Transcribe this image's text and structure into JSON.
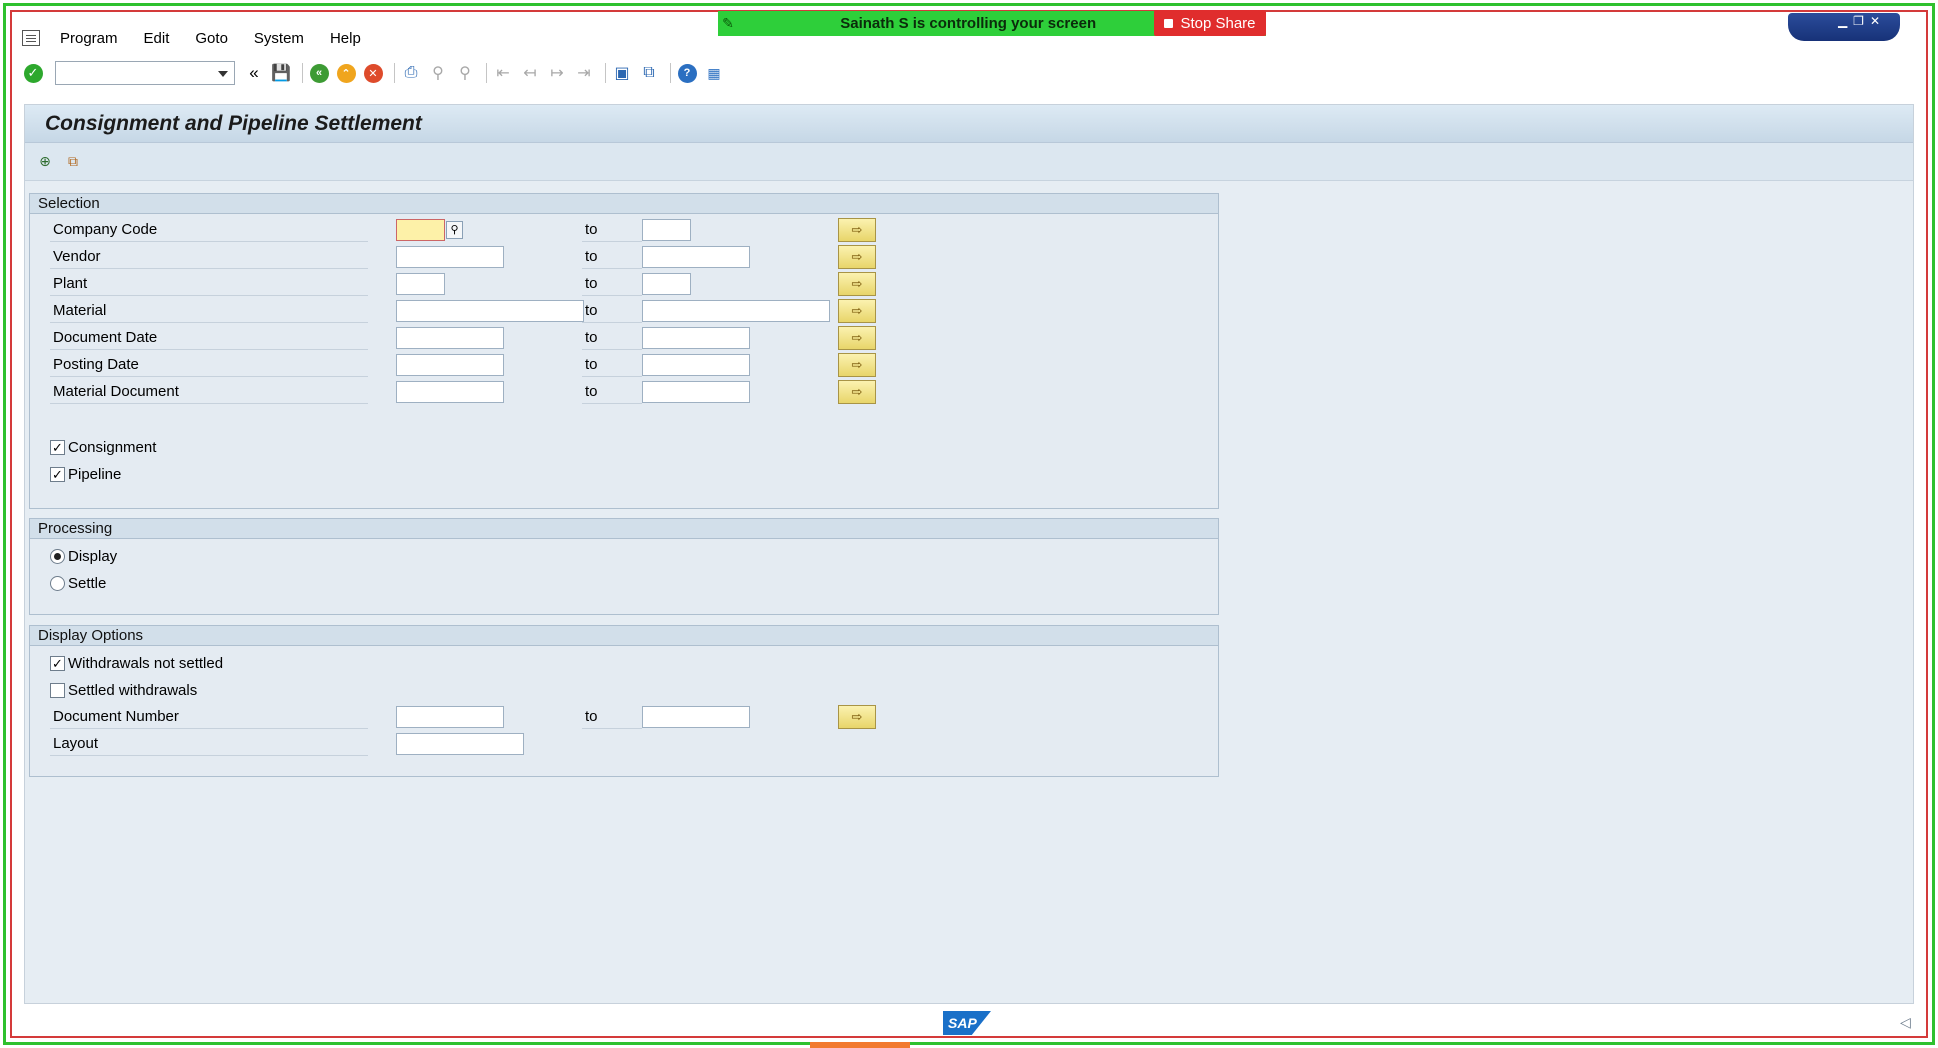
{
  "share": {
    "text": "Sainath S is controlling your screen",
    "stop_label": "Stop Share"
  },
  "menu": [
    "Program",
    "Edit",
    "Goto",
    "System",
    "Help"
  ],
  "toolbar": {
    "command_value": "",
    "icons": [
      "ok-icon",
      "save-icon",
      "back-icon",
      "exit-icon",
      "cancel-icon",
      "print-icon",
      "find-icon",
      "find-next-icon",
      "first-page-icon",
      "prev-page-icon",
      "next-page-icon",
      "last-page-icon",
      "new-session-icon",
      "shortcut-icon",
      "help-icon",
      "customize-layout-icon"
    ]
  },
  "page": {
    "title": "Consignment and Pipeline Settlement"
  },
  "selection": {
    "header": "Selection",
    "to_label": "to",
    "rows": [
      {
        "label": "Company Code"
      },
      {
        "label": "Vendor"
      },
      {
        "label": "Plant"
      },
      {
        "label": "Material"
      },
      {
        "label": "Document Date"
      },
      {
        "label": "Posting Date"
      },
      {
        "label": "Material Document"
      }
    ],
    "consignment_label": "Consignment",
    "consignment_checked": true,
    "pipeline_label": "Pipeline",
    "pipeline_checked": true
  },
  "processing": {
    "header": "Processing",
    "display_label": "Display",
    "settle_label": "Settle",
    "selected": "Display"
  },
  "display_options": {
    "header": "Display Options",
    "withdrawals_not_settled_label": "Withdrawals not settled",
    "withdrawals_not_settled_checked": true,
    "settled_withdrawals_label": "Settled withdrawals",
    "settled_withdrawals_checked": false,
    "document_number_label": "Document Number",
    "to_label": "to",
    "layout_label": "Layout"
  },
  "footer": {
    "logo": "SAP"
  }
}
